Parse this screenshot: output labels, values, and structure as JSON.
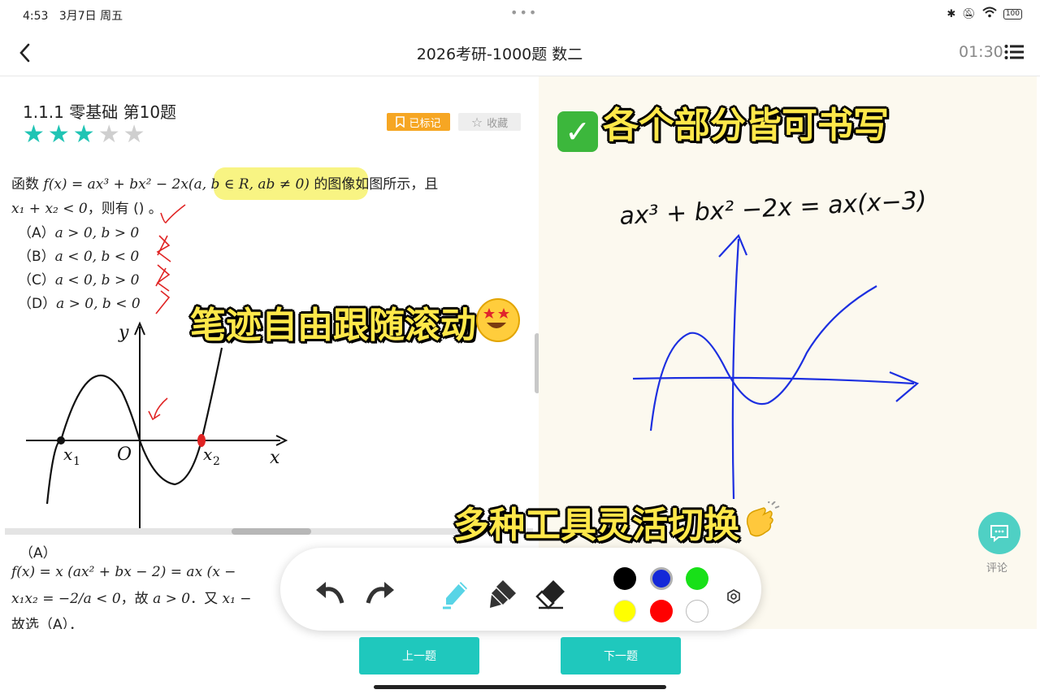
{
  "status": {
    "time": "4:53",
    "date": "3月7日 周五",
    "dots": "•••",
    "battery": "100"
  },
  "header": {
    "title": "2026考研-1000题 数二",
    "timer": "01:30"
  },
  "question": {
    "number": "1.1.1 零基础 第10题",
    "stars_filled": 3,
    "stars_total": 5,
    "stars_on": "★★★",
    "stars_off": "★★",
    "marked_label": "已标记",
    "collect_label": "收藏",
    "stem_prefix": "函数",
    "stem_math": "f(x) = ax³ + bx² − 2x(a, b ∈ R, ab ≠ 0)",
    "stem_suffix": "的图像如图所示，且",
    "stem_line2_math": "x₁ + x₂ < 0",
    "stem_line2_text": "，则有 () 。",
    "options": [
      {
        "label": "（A）",
        "math": "a > 0, b > 0"
      },
      {
        "label": "（B）",
        "math": "a < 0, b < 0"
      },
      {
        "label": "（C）",
        "math": "a < 0, b > 0"
      },
      {
        "label": "（D）",
        "math": "a > 0, b < 0"
      }
    ],
    "graph_labels": {
      "y": "y",
      "x": "x",
      "o": "O",
      "x1": "x",
      "x1_sub": "1",
      "x2": "x",
      "x2_sub": "2"
    }
  },
  "answer": {
    "label": "（A）",
    "line1": "f(x) = x (ax² + bx − 2) = ax (x −",
    "line2_math": "x₁x₂ = −2/a < 0",
    "line2_text": "，故",
    "line2_math2": "a > 0",
    "line2_text2": "．又",
    "line2_math3": "x₁ −",
    "line3": "故选（A）．"
  },
  "handwriting": {
    "equation": "ax³ + bx² −2x = ax(x−3)"
  },
  "banners": {
    "write": "各个部分皆可书写",
    "scroll": "笔迹自由跟随滚动",
    "tools": "多种工具灵活切换"
  },
  "toolbar": {
    "colors": [
      "#000000",
      "#1428d8",
      "#18e018",
      "#ffff00",
      "#ff0000",
      "#ffffff"
    ]
  },
  "comment": {
    "label": "评论"
  },
  "bottom": {
    "prev": "上一题",
    "next": "下一题"
  }
}
